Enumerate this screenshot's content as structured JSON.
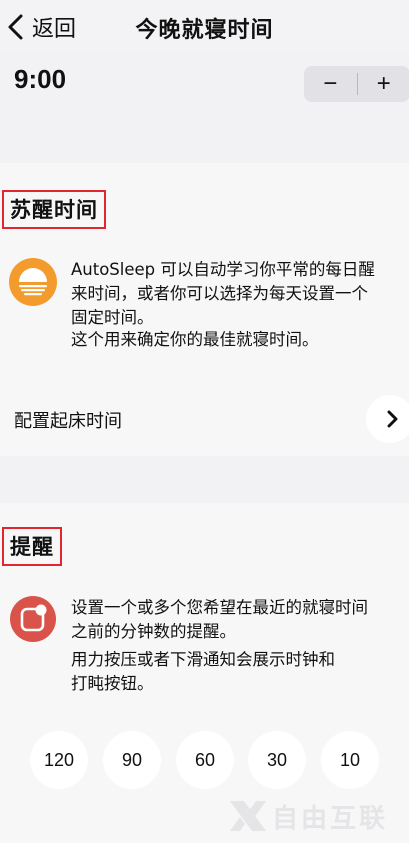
{
  "nav": {
    "back_label": "返回",
    "title": "今晚就寝时间"
  },
  "bedtime": {
    "time": "9:00",
    "minus": "−",
    "plus": "+"
  },
  "wake_section": {
    "title": "苏醒时间",
    "description": "AutoSleep 可以自动学习你平常的每日醒\n来时间，或者你可以选择为每天设置一个\n固定时间。",
    "note": "这个用来确定你的最佳就寝时间。",
    "config_label": "配置起床时间",
    "icon": "sun-horizon-icon",
    "icon_color": "#f39b2c"
  },
  "reminder_section": {
    "title": "提醒",
    "description": "设置一个或多个您希望在最近的就寝时间\n之前的分钟数的提醒。",
    "note": "用力按压或者下滑通知会展示时钟和\n打盹按钮。",
    "icon": "notification-icon",
    "icon_color": "#d9534a",
    "minutes": [
      "120",
      "90",
      "60",
      "30",
      "10"
    ]
  },
  "highlight_color": "#e0262f",
  "watermark": {
    "text": "自由互联"
  }
}
